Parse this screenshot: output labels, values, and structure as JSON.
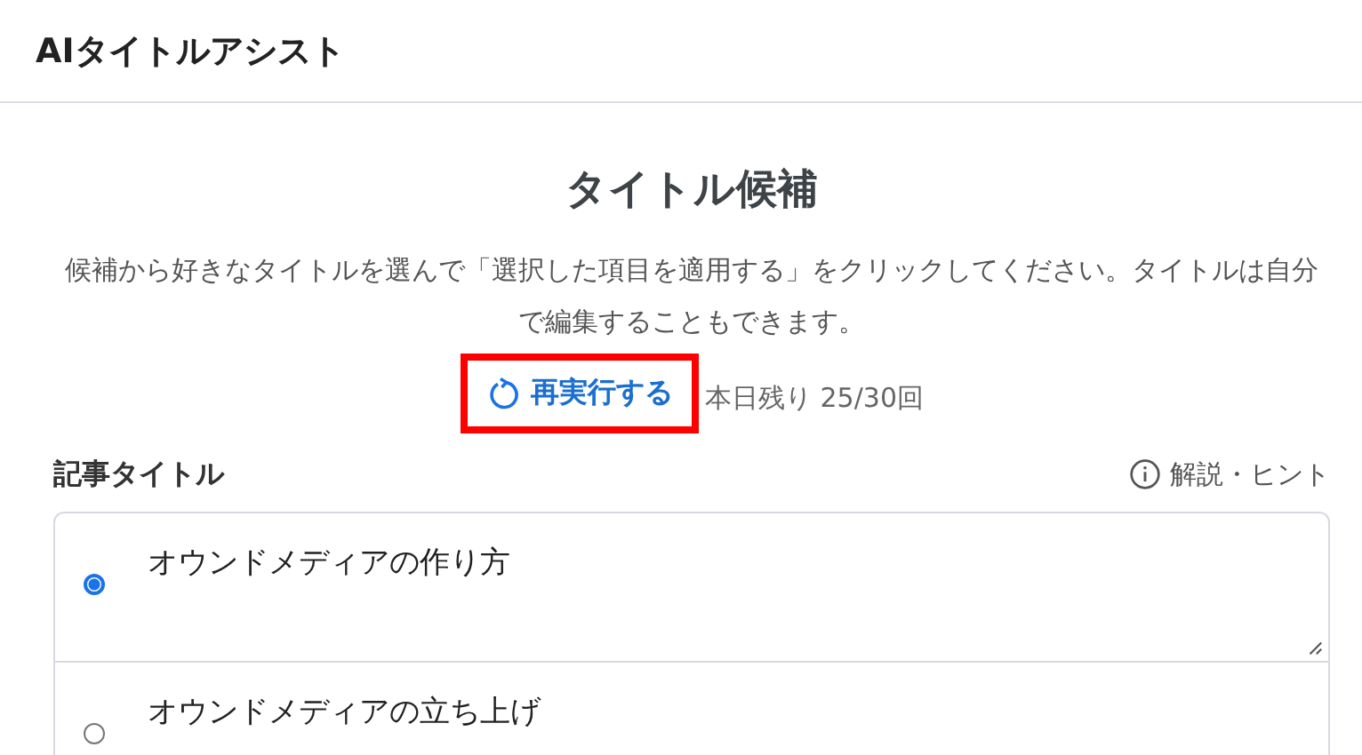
{
  "header": {
    "title": "AIタイトルアシスト"
  },
  "heading": "タイトル候補",
  "description": "候補から好きなタイトルを選んで「選択した項目を適用する」をクリックしてください。タイトルは自分で編集することもできます。",
  "rerun_button": {
    "label": "再実行する",
    "highlighted": true
  },
  "remaining": "本日残り 25/30回",
  "section_label": "記事タイトル",
  "hint_link": "解説・ヒント",
  "candidates": [
    {
      "text": "オウンドメディアの作り方",
      "selected": true
    },
    {
      "text": "オウンドメディアの立ち上げ",
      "selected": false
    }
  ]
}
